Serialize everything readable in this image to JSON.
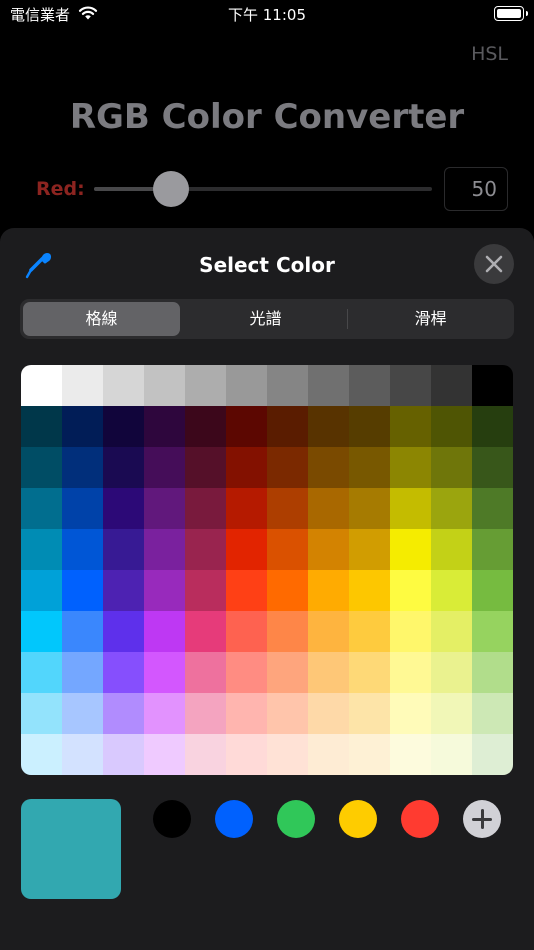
{
  "status_bar": {
    "carrier": "電信業者",
    "time": "下午 11:05"
  },
  "header": {
    "mode_button": "HSL",
    "title": "RGB Color Converter"
  },
  "red_control": {
    "label": "Red:",
    "value": "50",
    "fraction": 0.2275,
    "label_color": "#8c2420"
  },
  "sheet": {
    "title": "Select Color",
    "tabs": [
      {
        "label": "格線",
        "active": true
      },
      {
        "label": "光譜",
        "active": false
      },
      {
        "label": "滑桿",
        "active": false
      }
    ],
    "grid_rows": [
      [
        "#ffffff",
        "#ebebeb",
        "#d6d6d6",
        "#c2c2c2",
        "#adadad",
        "#999999",
        "#858585",
        "#707070",
        "#5c5c5c",
        "#474747",
        "#333333",
        "#000000"
      ],
      [
        "#00374a",
        "#011d57",
        "#11053b",
        "#2e063d",
        "#3c071b",
        "#5c0701",
        "#5a1c00",
        "#583300",
        "#563d00",
        "#666100",
        "#4f5504",
        "#263e0f"
      ],
      [
        "#004d65",
        "#012f7b",
        "#1a0a52",
        "#450d59",
        "#551029",
        "#831100",
        "#7b2900",
        "#7a4a00",
        "#785800",
        "#8c8602",
        "#6f760a",
        "#38571a"
      ],
      [
        "#016e8f",
        "#0042a9",
        "#2c0977",
        "#61187c",
        "#791a3d",
        "#b51a00",
        "#ad3e00",
        "#a96800",
        "#a67b01",
        "#c4bc00",
        "#9ba50e",
        "#4e7a27"
      ],
      [
        "#008cb4",
        "#0056d6",
        "#371a94",
        "#7a219e",
        "#99244f",
        "#e22400",
        "#da5100",
        "#d38301",
        "#d19d01",
        "#f5ec00",
        "#c3d117",
        "#669d34"
      ],
      [
        "#00a1d8",
        "#0061fe",
        "#4d22b2",
        "#982abc",
        "#b92d5d",
        "#ff4015",
        "#ff6a00",
        "#ffab01",
        "#fdc700",
        "#fefb41",
        "#d9ec37",
        "#76bb40"
      ],
      [
        "#01c7fc",
        "#3a87fd",
        "#5e30eb",
        "#be38f3",
        "#e63b7a",
        "#fe6250",
        "#fe8648",
        "#feb43f",
        "#fecb3e",
        "#fff76b",
        "#e4ef65",
        "#96d35f"
      ],
      [
        "#52d6fc",
        "#74a7ff",
        "#864ffd",
        "#d357fe",
        "#ee719e",
        "#ff8c82",
        "#fea57d",
        "#fec777",
        "#fed977",
        "#fff994",
        "#eaf28f",
        "#b1dd8b"
      ],
      [
        "#93e3fc",
        "#a7c6ff",
        "#b18cfe",
        "#e292fe",
        "#f4a4c0",
        "#ffb5af",
        "#ffc5ab",
        "#fed9a8",
        "#fde4a8",
        "#fffbb9",
        "#f1f7b7",
        "#cde8b5"
      ],
      [
        "#cbf0ff",
        "#d3e2ff",
        "#d9c9fe",
        "#efcaff",
        "#f9d3e0",
        "#ffdad8",
        "#ffe2d6",
        "#feecd4",
        "#fef1d5",
        "#fdfbdd",
        "#f6fadb",
        "#deeed4"
      ]
    ],
    "selected_color": "#32a8b0",
    "presets": [
      "#000000",
      "#0061fe",
      "#30c759",
      "#fecc00",
      "#ff3b30"
    ]
  }
}
